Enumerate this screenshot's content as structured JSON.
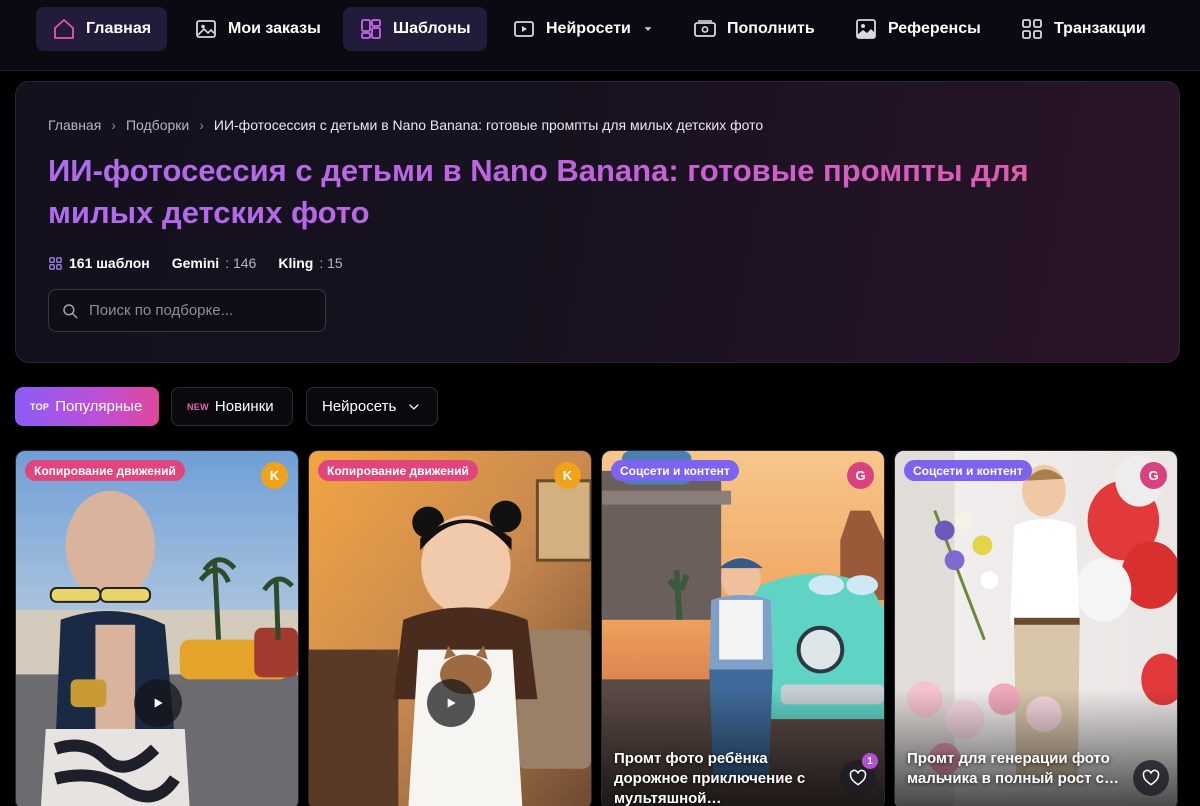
{
  "nav": {
    "items": [
      {
        "label": "Главная",
        "icon": "home-icon",
        "active": true
      },
      {
        "label": "Мои заказы",
        "icon": "image-icon",
        "active": false
      },
      {
        "label": "Шаблоны",
        "icon": "templates-icon",
        "active": true
      },
      {
        "label": "Нейросети",
        "icon": "play-box-icon",
        "active": false
      },
      {
        "label": "Пополнить",
        "icon": "wallet-icon",
        "active": false
      },
      {
        "label": "Референсы",
        "icon": "picture-icon",
        "active": false
      },
      {
        "label": "Транзакции",
        "icon": "grid-icon",
        "active": false
      }
    ]
  },
  "breadcrumb": {
    "home": "Главная",
    "collections": "Подборки",
    "current": "ИИ-фотосессия с детьми в Nano Banana: готовые промпты для милых детских фото"
  },
  "hero": {
    "title": "ИИ-фотосессия с детьми в Nano Banana: готовые промпты для милых детских фото",
    "templates_count": "161 шаблон",
    "gemini_label": "Gemini",
    "gemini_value": ": 146",
    "kling_label": "Kling",
    "kling_value": ": 15"
  },
  "search": {
    "placeholder": "Поиск по подборке...",
    "value": ""
  },
  "filters": {
    "popular_tag": "TOP",
    "popular_label": "Популярные",
    "new_tag": "NEW",
    "new_label": "Новинки",
    "network_label": "Нейросеть"
  },
  "cards": [
    {
      "badge": "Копирование движений",
      "model": "K",
      "title": "",
      "has_play": true
    },
    {
      "badge": "Копирование движений",
      "model": "K",
      "title": "",
      "has_play": true
    },
    {
      "badge": "Соцсети и контент",
      "model": "G",
      "title": "Промт фото ребёнка дорожное приключение с мультяшной…",
      "likes": "1"
    },
    {
      "badge": "Соцсети и контент",
      "model": "G",
      "title": "Промт для генерации фото мальчика в полный рост с…"
    }
  ],
  "colors": {
    "accent_purple": "#8b5cf6",
    "accent_pink": "#e0479a",
    "badge_motion": "#e2457e",
    "badge_social": "#7c63f2",
    "kling_dot": "#f0a21a",
    "gemini_dot": "#d8437f"
  }
}
